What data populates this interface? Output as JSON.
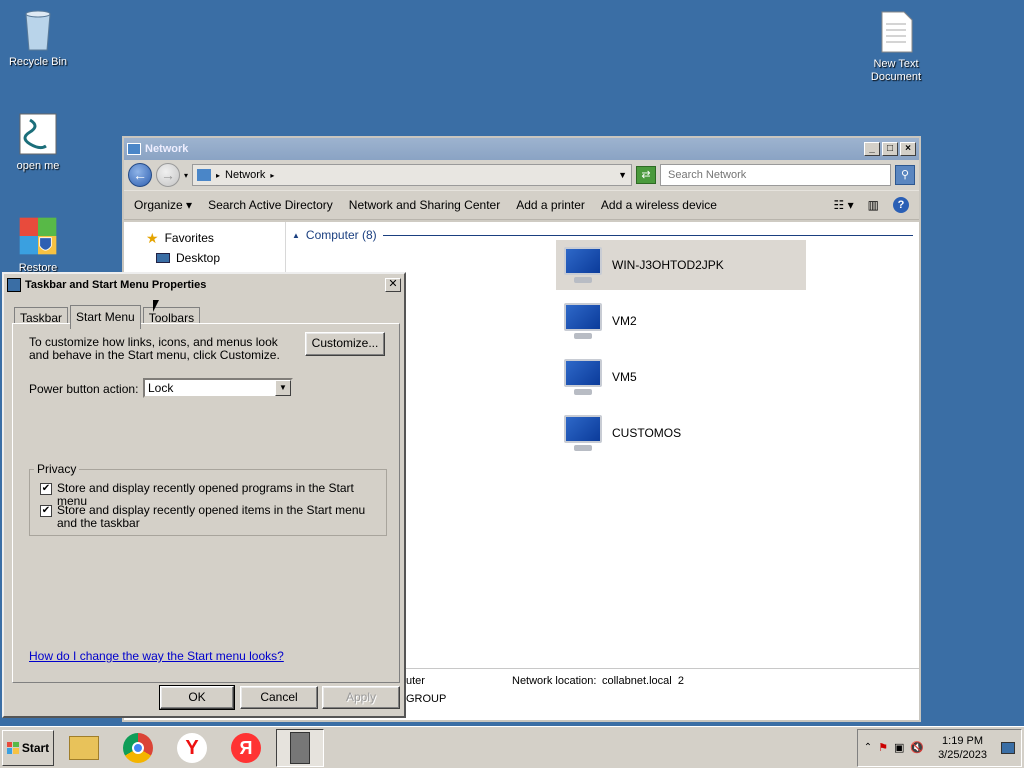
{
  "desktop": {
    "icons": [
      {
        "label": "Recycle Bin",
        "icon": "recycle-bin-icon"
      },
      {
        "label": "open me",
        "icon": "script-file-icon"
      },
      {
        "label": "Restore",
        "icon": "restore-shield-icon"
      },
      {
        "label": "New Text Document",
        "icon": "text-document-icon"
      }
    ]
  },
  "explorer": {
    "title": "Network",
    "address": {
      "segments": [
        "Network"
      ],
      "separator": "▸"
    },
    "search_placeholder": "Search Network",
    "toolbar": {
      "organize": "Organize",
      "search_ad": "Search Active Directory",
      "network_sharing": "Network and Sharing Center",
      "add_printer": "Add a printer",
      "add_wireless": "Add a wireless device"
    },
    "nav": {
      "favorites": "Favorites",
      "desktop": "Desktop"
    },
    "group_header": "Computer (8)",
    "computers": [
      "WIN-J3OHTOD2JPK",
      "VM2",
      "VM5",
      "CUSTOMOS"
    ],
    "details": {
      "type_fragment": "uter",
      "workgroup_fragment": "GROUP",
      "network_location_label": "Network location:",
      "network_location_value": "collabnet.local  2"
    }
  },
  "dialog": {
    "title": "Taskbar and Start Menu Properties",
    "tabs": [
      "Taskbar",
      "Start Menu",
      "Toolbars"
    ],
    "active_tab": "Start Menu",
    "description": "To customize how links, icons, and menus look and behave in the Start menu, click Customize.",
    "customize_label": "Customize...",
    "power_label": "Power button action:",
    "power_value": "Lock",
    "privacy_legend": "Privacy",
    "check1": "Store and display recently opened programs in the Start menu",
    "check2": "Store and display recently opened items in the Start menu and the taskbar",
    "help_link": "How do I change the way the Start menu looks?",
    "ok": "OK",
    "cancel": "Cancel",
    "apply": "Apply"
  },
  "taskbar": {
    "start_label": "Start",
    "apps": [
      "file-explorer-icon",
      "chrome-icon",
      "yandex-browser-icon",
      "yandex-icon",
      "server-manager-icon"
    ],
    "time": "1:19 PM",
    "date": "3/25/2023"
  },
  "colors": {
    "desktop": "#3a6ea5",
    "selection": "#dcd8d2",
    "link": "#0000cc",
    "group_header": "#1a3f80"
  }
}
